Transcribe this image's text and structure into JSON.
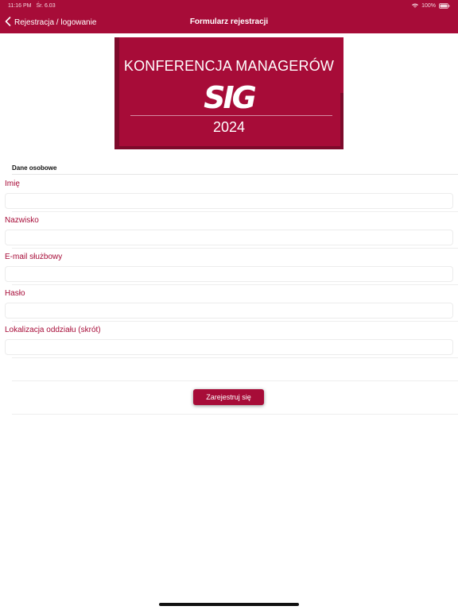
{
  "status_bar": {
    "time": "11:16 PM",
    "date": "Śr. 6.03",
    "battery": "100%"
  },
  "nav": {
    "back_label": "Rejestracja / logowanie",
    "title": "Formularz rejestracji"
  },
  "banner": {
    "title": "KONFERENCJA MANAGERÓW",
    "logo": "SIG",
    "year": "2024"
  },
  "form": {
    "section_title": "Dane osobowe",
    "fields": [
      {
        "label": "Imię",
        "value": ""
      },
      {
        "label": "Nazwisko",
        "value": ""
      },
      {
        "label": "E-mail służbowy",
        "value": ""
      },
      {
        "label": "Hasło",
        "value": ""
      },
      {
        "label": "Lokalizacja oddziału (skrót)",
        "value": ""
      }
    ],
    "submit_label": "Zarejestruj się"
  },
  "colors": {
    "accent": "#a70c38",
    "banner_shade": "#7d0a2b"
  }
}
